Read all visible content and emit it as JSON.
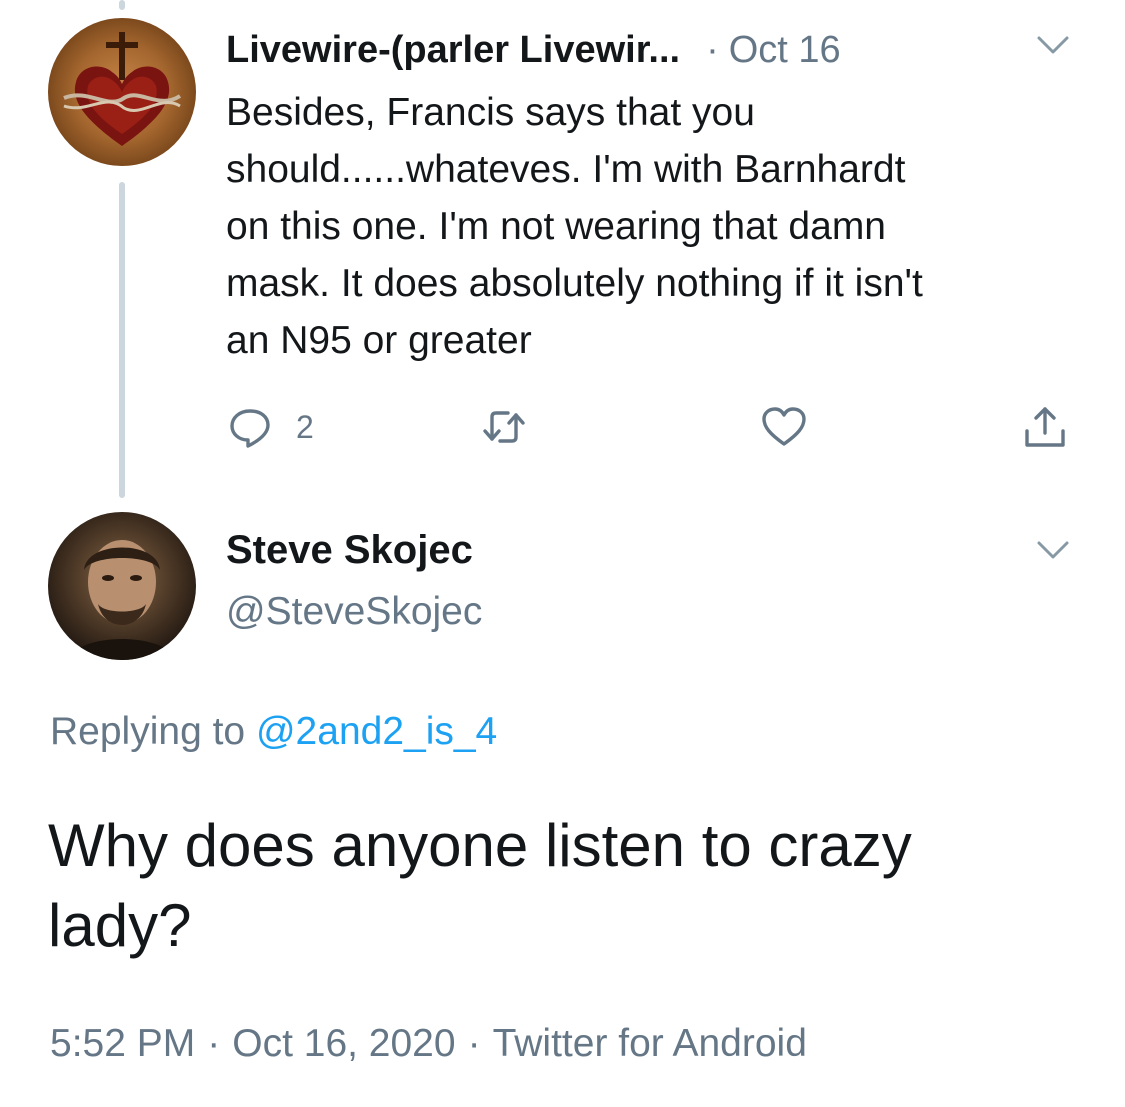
{
  "reply_tweet": {
    "display_name": "Livewire-(parler Livewir...",
    "separator": "·",
    "date": "Oct 16",
    "text": "Besides, Francis says that you\nshould......whateves.  I'm with Barnhardt\non this one. I'm not wearing that damn\nmask. It does absolutely nothing if it isn't\nan N95 or greater",
    "reply_count": "2",
    "icons": {
      "reply": "reply-icon",
      "retweet": "retweet-icon",
      "like": "heart-icon",
      "share": "share-icon",
      "more": "chevron-down-icon"
    }
  },
  "main_tweet": {
    "display_name": "Steve Skojec",
    "handle": "@SteveSkojec",
    "replying_label": "Replying to",
    "replying_handle": "@2and2_is_4",
    "text": "Why does anyone listen to crazy\nlady?",
    "time": "5:52 PM",
    "date": "Oct 16, 2020",
    "client": "Twitter for Android",
    "separator": "·"
  },
  "colors": {
    "text": "#14171a",
    "secondary": "#657786",
    "link": "#1da1f2",
    "thread_line": "#ccd6dd"
  }
}
